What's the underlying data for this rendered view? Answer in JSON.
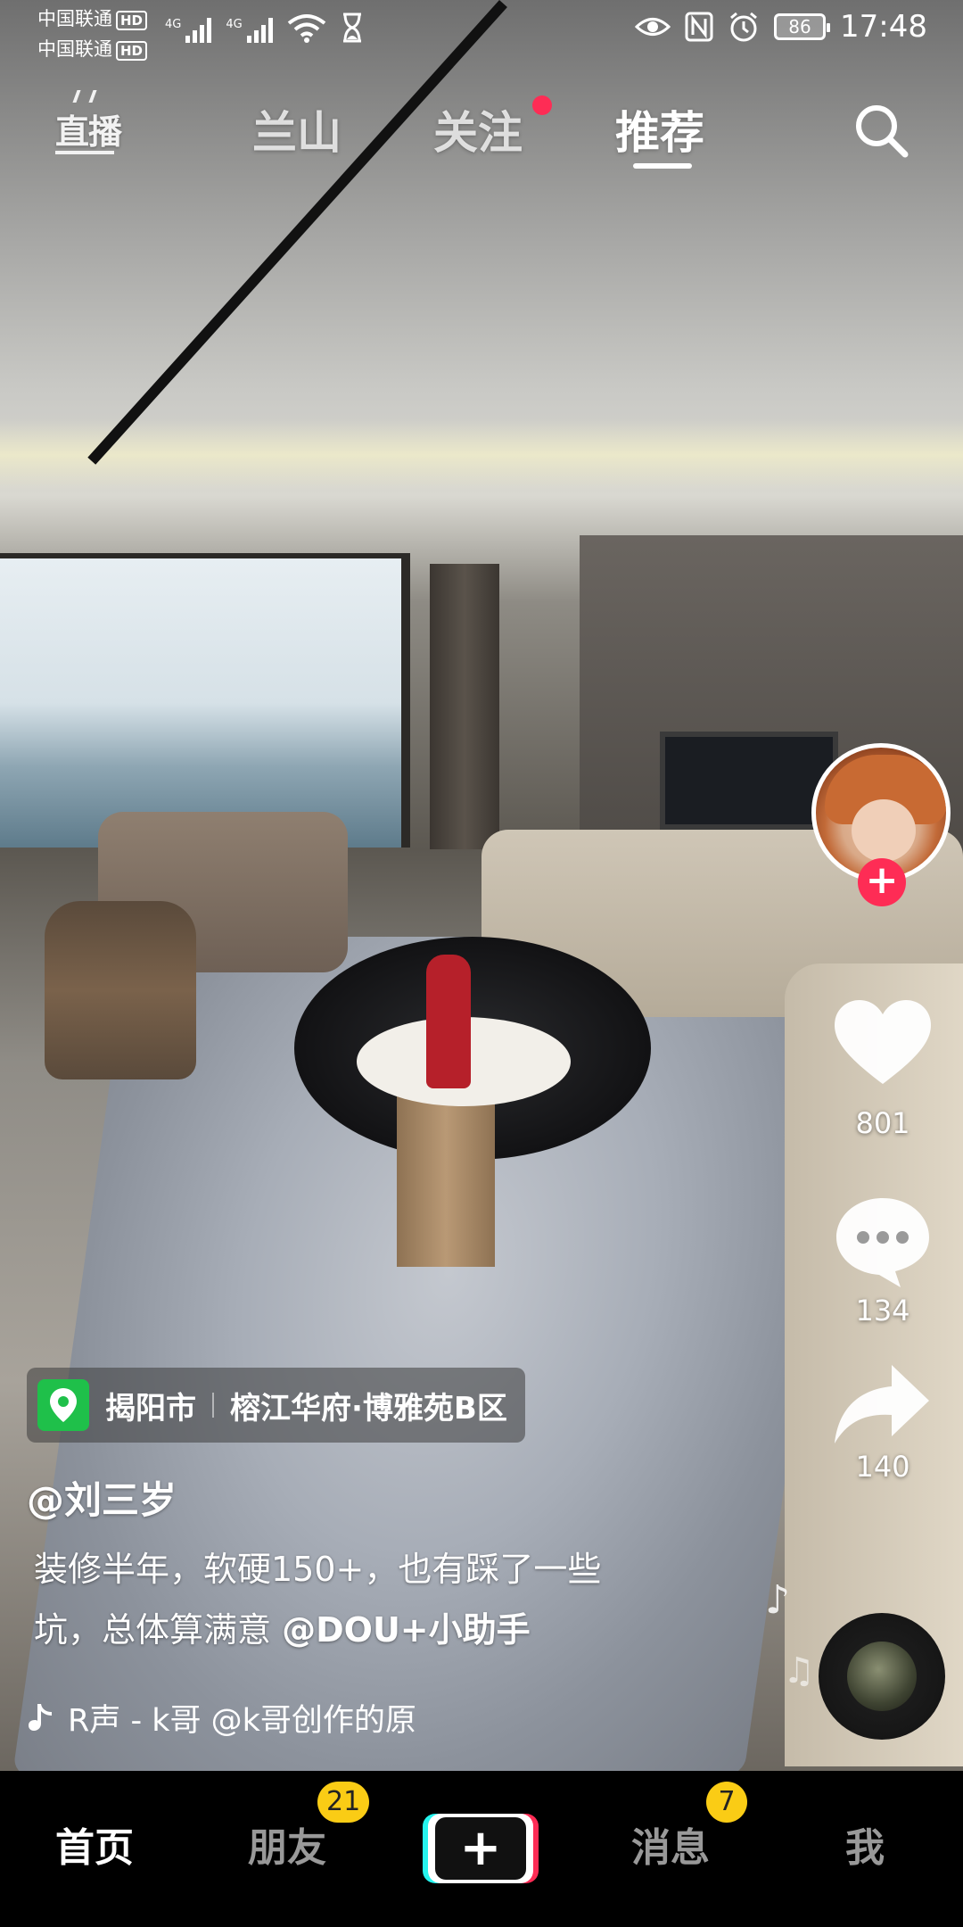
{
  "status_bar": {
    "carrier_1": "中国联通",
    "carrier_2": "中国联通",
    "hd_label": "HD",
    "network_1": "4G",
    "network_2": "4G",
    "battery": "86",
    "time": "17:48"
  },
  "top_nav": {
    "live_label": "直播",
    "tabs": [
      {
        "label": "兰山"
      },
      {
        "label": "关注"
      },
      {
        "label": "推荐"
      }
    ],
    "active_tab": "推荐"
  },
  "right_rail": {
    "like_count": "801",
    "comment_count": "134",
    "share_count": "140",
    "follow_symbol": "+"
  },
  "location": {
    "city": "揭阳市",
    "place": "榕江华府·博雅苑B区"
  },
  "post": {
    "author": "@刘三岁",
    "description_line_1": "装修半年，软硬150+，也有踩了一些",
    "description_line_2_prefix": "坑，总体算满意 ",
    "mention": "@DOU+小助手",
    "music_text": "R声 - k哥    @k哥创作的原"
  },
  "bottom_nav": {
    "home": "首页",
    "friends": "朋友",
    "friends_badge": "21",
    "add_symbol": "+",
    "messages": "消息",
    "messages_badge": "7",
    "me": "我"
  },
  "colors": {
    "accent_red": "#fe2c55",
    "accent_cyan": "#25f4ee",
    "badge_yellow": "#facc15",
    "location_green": "#1fc04a"
  }
}
